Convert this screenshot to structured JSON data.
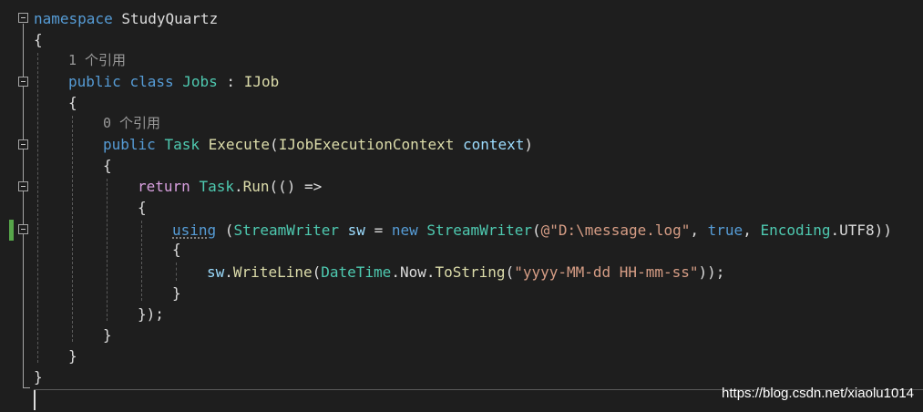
{
  "colors": {
    "background": "#1e1e1e",
    "keyword": "#569cd6",
    "control_keyword": "#d8a0df",
    "type": "#4ec9b0",
    "method": "#dcdcaa",
    "parameter": "#9cdcfe",
    "string": "#d69d85",
    "plain": "#dcdcdc",
    "codelens": "#9a9a9a",
    "change_marker": "#57a64a"
  },
  "code": {
    "l1": {
      "kw": "namespace",
      "name": " StudyQuartz"
    },
    "l2": {
      "text": "{"
    },
    "l3": {
      "lens": "1 个引用"
    },
    "l4": {
      "kw1": "public",
      "kw2": "class",
      "cls": "Jobs",
      "sep": " : ",
      "iface": "IJob"
    },
    "l5": {
      "text": "{"
    },
    "l6": {
      "lens": "0 个引用"
    },
    "l7": {
      "kw": "public",
      "type": "Task",
      "method": "Execute",
      "open": "(",
      "ptype": "IJobExecutionContext",
      "pname": "context",
      "close": ")"
    },
    "l8": {
      "text": "{"
    },
    "l9": {
      "kw": "return",
      "type": "Task",
      "dot": ".",
      "method": "Run",
      "rest": "(() =>"
    },
    "l10": {
      "text": "{"
    },
    "l11": {
      "kw": "using",
      "open": " (",
      "type": "StreamWriter",
      "var": "sw",
      "eq": " = ",
      "new": "new",
      "ctor": "StreamWriter",
      "p1": "(",
      "str": "@\"D:\\message.log\"",
      "comma1": ", ",
      "bool": "true",
      "comma2": ", ",
      "enc": "Encoding",
      "rest": ".UTF8))"
    },
    "l12": {
      "text": "{"
    },
    "l13": {
      "var": "sw",
      "dot": ".",
      "method": "WriteLine",
      "p1": "(",
      "type": "DateTime",
      "dot2": ".",
      "now": "Now",
      "dot3": ".",
      "method2": "ToString",
      "p2": "(",
      "str": "\"yyyy-MM-dd HH-mm-ss\"",
      "rest": "));"
    },
    "l14": {
      "text": "}"
    },
    "l15": {
      "text": "});"
    },
    "l16": {
      "text": "}"
    },
    "l17": {
      "text": "}"
    },
    "l18": {
      "text": "}"
    }
  },
  "watermark": "https://blog.csdn.net/xiaolu1014"
}
